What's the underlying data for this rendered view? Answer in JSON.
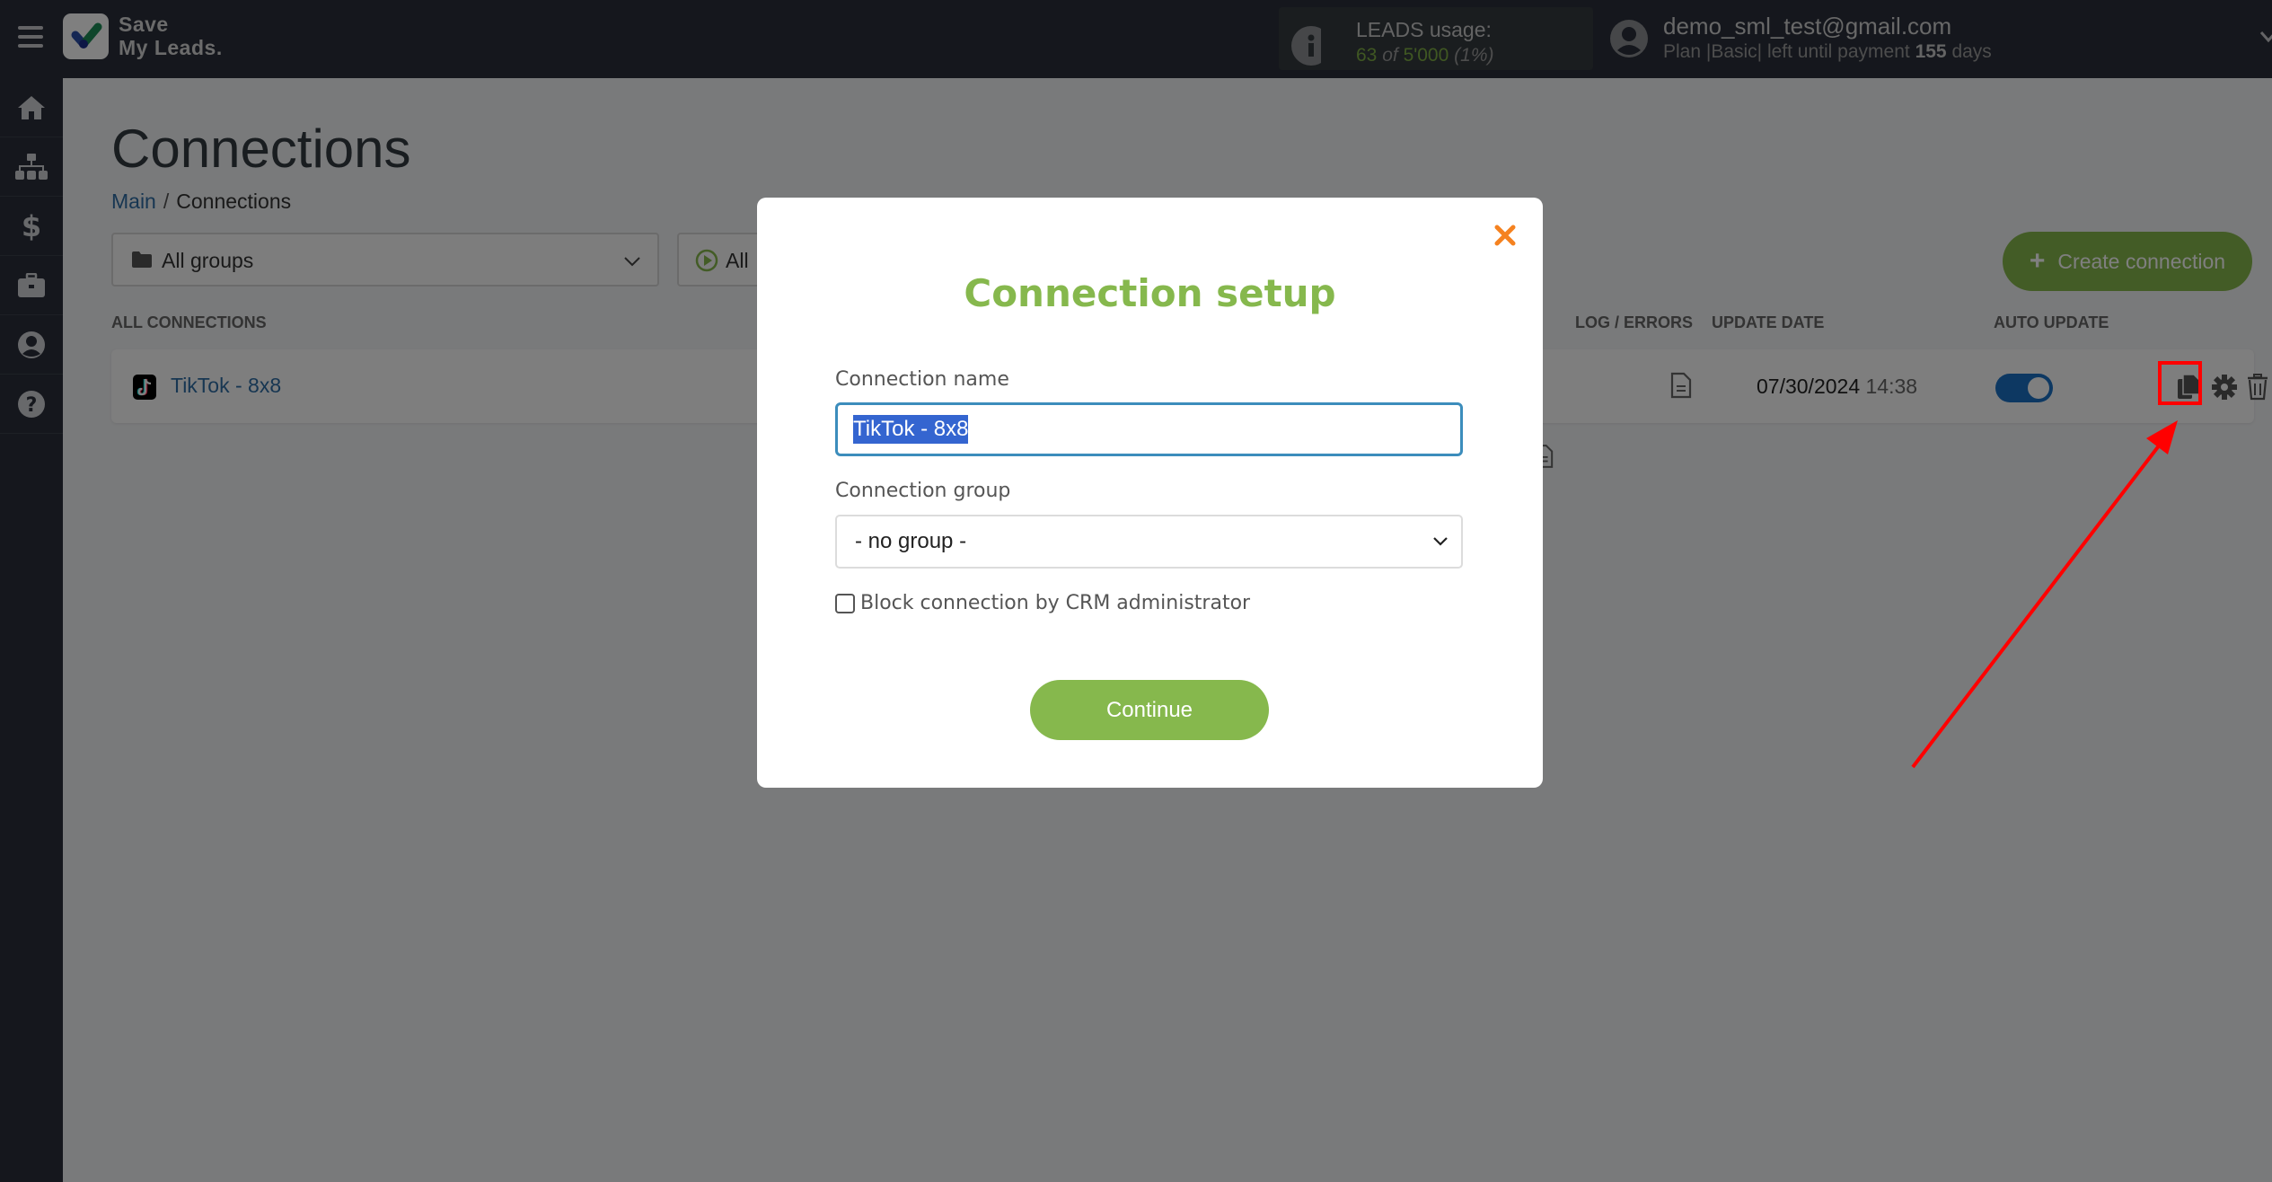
{
  "header": {
    "logo_line1": "Save",
    "logo_line2": "My Leads.",
    "leads_usage_label": "LEADS usage:",
    "leads_used": "63",
    "leads_of": "of",
    "leads_total": "5'000",
    "leads_percent": "(1%)",
    "user_email": "demo_sml_test@gmail.com",
    "plan_prefix": "Plan |Basic| left until payment",
    "plan_days": "155",
    "plan_suffix": "days"
  },
  "sidebar": {
    "items": [
      {
        "icon": "home-icon"
      },
      {
        "icon": "sitemap-icon"
      },
      {
        "icon": "dollar-icon"
      },
      {
        "icon": "briefcase-icon"
      },
      {
        "icon": "user-circle-icon"
      },
      {
        "icon": "question-circle-icon"
      }
    ]
  },
  "page": {
    "title": "Connections",
    "breadcrumb": {
      "home": "Main",
      "separator": "/",
      "current": "Connections"
    },
    "filters": {
      "group": "All groups",
      "status": "All"
    },
    "create_button": "Create connection",
    "table": {
      "headers": {
        "name": "ALL CONNECTIONS",
        "log": "LOG / ERRORS",
        "update_date": "UPDATE DATE",
        "auto_update": "AUTO UPDATE"
      },
      "rows": [
        {
          "name": "TikTok - 8x8",
          "date": "07/30/2024",
          "time": "14:38",
          "auto_update": true
        }
      ]
    }
  },
  "modal": {
    "title": "Connection setup",
    "name_label": "Connection name",
    "name_value": "TikTok - 8x8",
    "group_label": "Connection group",
    "group_value": "- no group -",
    "block_label": "Block connection by CRM administrator",
    "block_checked": false,
    "continue_label": "Continue"
  },
  "colors": {
    "accent_green": "#86b84d",
    "link_blue": "#2e6da4",
    "close_orange": "#f58220",
    "annotation_red": "#ff0000"
  }
}
